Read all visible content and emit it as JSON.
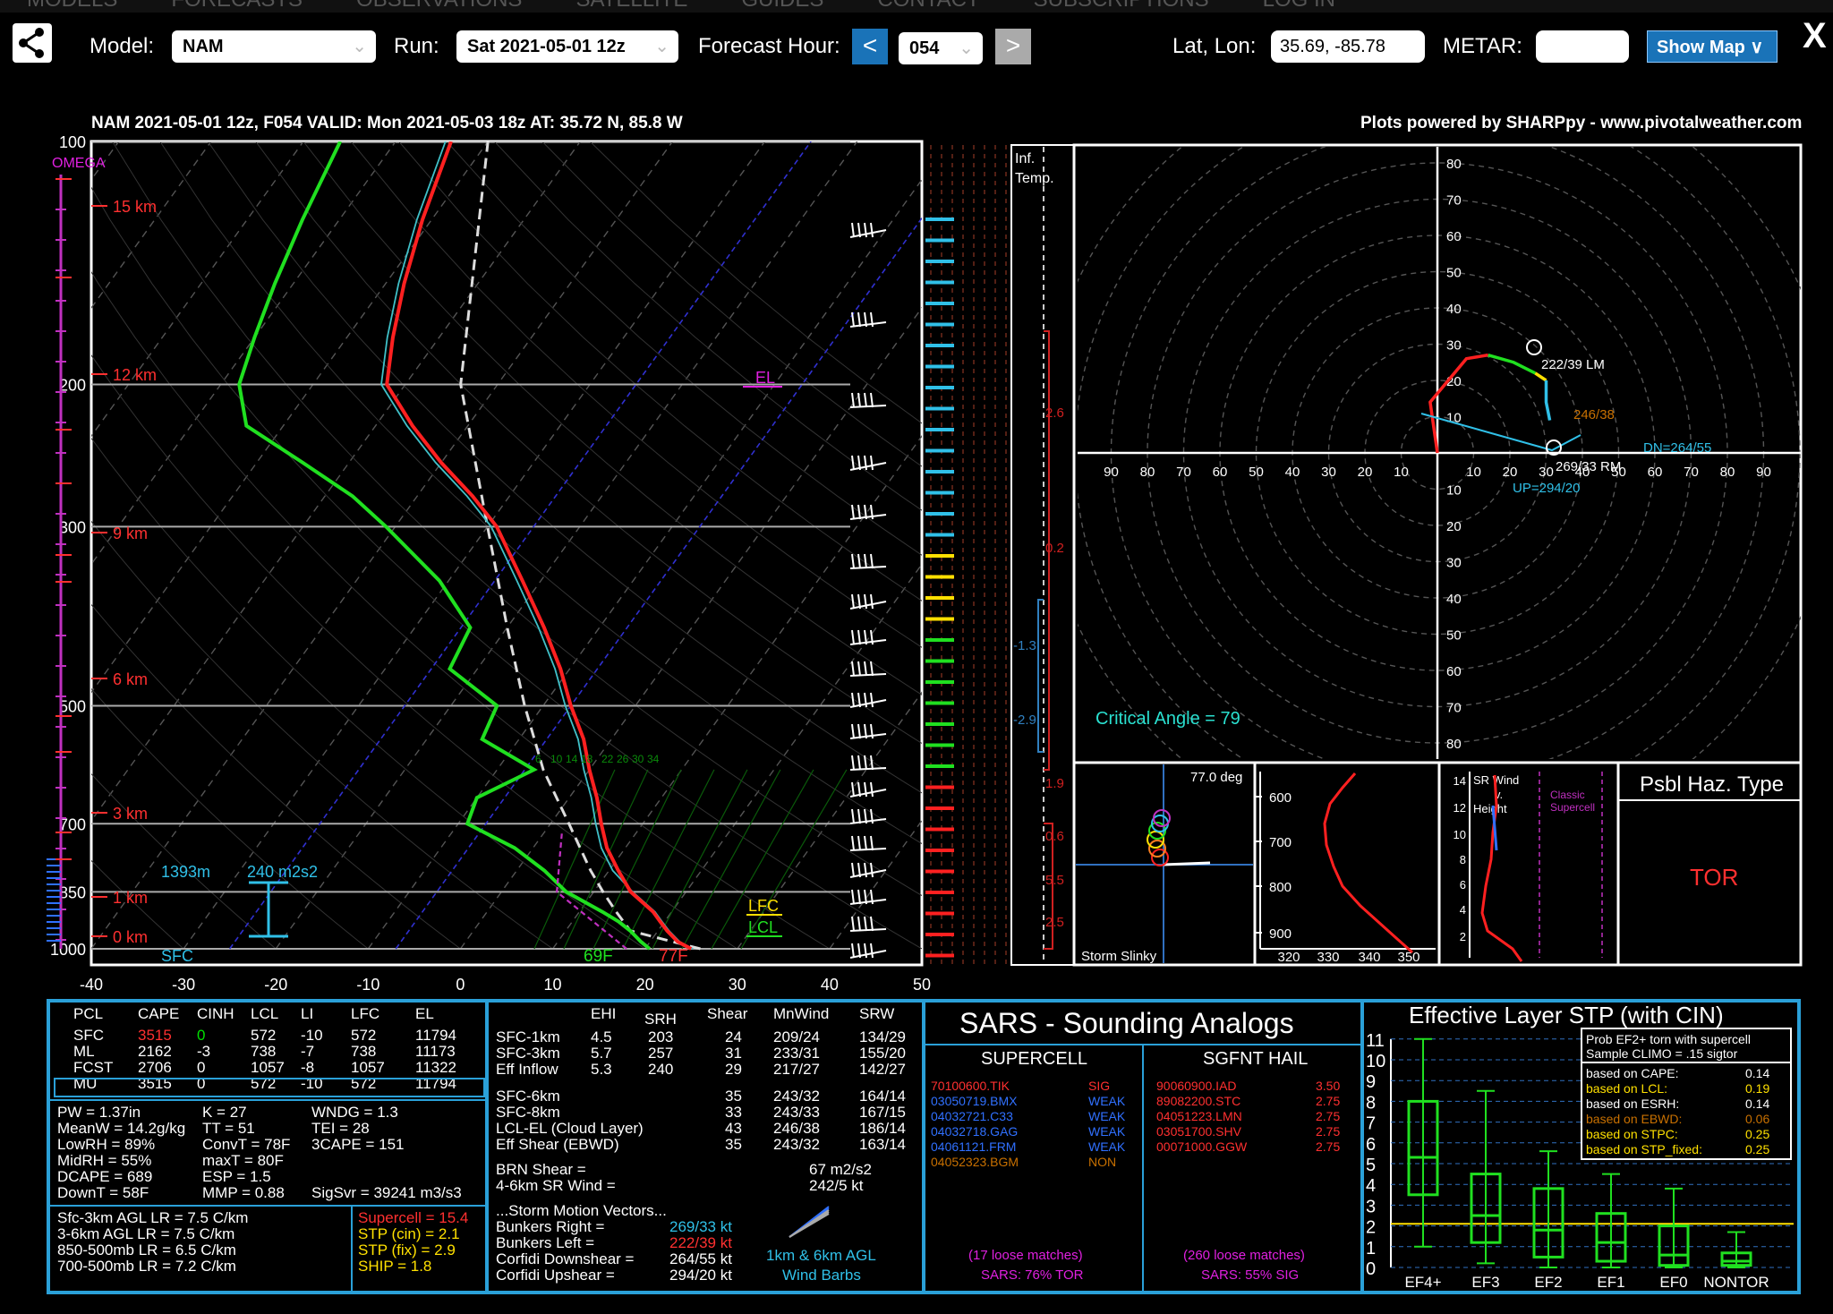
{
  "nav": {
    "items": [
      "MODELS",
      "FORECASTS",
      "OBSERVATIONS",
      "SATELLITE",
      "GUIDES",
      "CONTACT",
      "SUBSCRIPTIONS",
      "LOG IN"
    ]
  },
  "toolbar": {
    "model_label": "Model:",
    "model_value": "NAM",
    "run_label": "Run:",
    "run_value": "Sat 2021-05-01 12z",
    "fh_label": "Forecast Hour:",
    "fh_prev": "<",
    "fh_value": "054",
    "fh_next": ">",
    "latlon_label": "Lat, Lon:",
    "latlon_value": "35.69, -85.78",
    "metar_label": "METAR:",
    "metar_value": "",
    "showmap": "Show Map ∨",
    "close": "X"
  },
  "skewt": {
    "title": "NAM 2021-05-01 12z, F054  VALID: Mon 2021-05-03 18z  AT: 35.72 N, 85.8 W",
    "credit": "Plots powered by SHARPpy - www.pivotalweather.com",
    "omega": "OMEGA",
    "pressure_ticks": [
      "100",
      "200",
      "300",
      "500",
      "700",
      "850",
      "1000"
    ],
    "height_ticks": [
      "15 km",
      "12 km",
      "9 km",
      "6 km",
      "3 km",
      "1 km",
      "0 km"
    ],
    "temp_ticks": [
      "-40",
      "-30",
      "-20",
      "-10",
      "0",
      "10",
      "20",
      "30",
      "40",
      "50"
    ],
    "mixing_ticks": [
      "6",
      "10",
      "14",
      "18",
      "22",
      "26",
      "30",
      "34"
    ],
    "el": "EL",
    "lfc": "LFC",
    "lcl": "LCL",
    "sfc": "SFC",
    "eff_depth": "1393m",
    "eff_srh": "240 m2s2",
    "sfc_td": "69F",
    "sfc_t": "77F",
    "inf_temp": "Inf.\nTemp.",
    "inf_vals": [
      "2.6",
      "0.2",
      "-1.3",
      "-2.9",
      "1.9",
      "0.6",
      "5.5",
      "2.5"
    ]
  },
  "hodo": {
    "rings": [
      "10",
      "20",
      "30",
      "40",
      "50",
      "60",
      "70",
      "80"
    ],
    "x_left": [
      "90",
      "80",
      "70",
      "60",
      "50",
      "40",
      "30",
      "20",
      "10"
    ],
    "x_right": [
      "10",
      "20",
      "30",
      "40",
      "50",
      "60",
      "70",
      "80",
      "90"
    ],
    "lm": "222/39 LM",
    "rm": "269/33 RM",
    "dn": "DN=264/55",
    "up": "UP=294/20",
    "mean": "246/38",
    "critical": "Critical Angle = 79"
  },
  "slinky": {
    "deg": "77.0 deg",
    "label": "Storm Slinky"
  },
  "theta": {
    "y": [
      "600",
      "700",
      "800",
      "900"
    ],
    "x": [
      "320",
      "330",
      "340",
      "350"
    ]
  },
  "srwind": {
    "title": "SR Wind\nv.\nHeight",
    "classic": "Classic\nSupercell",
    "y": [
      "14",
      "12",
      "10",
      "8",
      "6",
      "4",
      "2"
    ]
  },
  "haz": {
    "title": "Psbl Haz. Type",
    "value": "TOR"
  },
  "parcels": {
    "headers": [
      "PCL",
      "CAPE",
      "CINH",
      "LCL",
      "LI",
      "LFC",
      "EL"
    ],
    "rows": [
      [
        "SFC",
        "3515",
        "0",
        "572",
        "-10",
        "572",
        "11794"
      ],
      [
        "ML",
        "2162",
        "-3",
        "738",
        "-7",
        "738",
        "11173"
      ],
      [
        "FCST",
        "2706",
        "0",
        "1057",
        "-8",
        "1057",
        "11322"
      ],
      [
        "MU",
        "3515",
        "0",
        "572",
        "-10",
        "572",
        "11794"
      ]
    ]
  },
  "indices": {
    "col1": [
      "PW = 1.37in",
      "MeanW = 14.2g/kg",
      "LowRH = 89%",
      "MidRH = 55%",
      "DCAPE = 689",
      "DownT = 58F"
    ],
    "col2": [
      "K = 27",
      "TT = 51",
      "ConvT = 78F",
      "maxT = 80F",
      "ESP = 1.5",
      "MMP = 0.88"
    ],
    "col3": [
      "WNDG = 1.3",
      "TEI = 28",
      "3CAPE = 151",
      "",
      "",
      "SigSvr = 39241 m3/s3"
    ]
  },
  "lapse": [
    "Sfc-3km AGL LR = 7.5 C/km",
    "3-6km AGL LR = 7.5 C/km",
    "850-500mb LR = 6.5 C/km",
    "700-500mb LR = 7.2 C/km"
  ],
  "comp": [
    "Supercell = 15.4",
    "STP (cin) = 2.1",
    "STP (fix) = 2.9",
    "SHIP = 1.8"
  ],
  "kin": {
    "headers": [
      "EHI",
      "SRH",
      "Shear",
      "MnWind",
      "SRW"
    ],
    "rows": [
      [
        "SFC-1km",
        "4.5",
        "203",
        "24",
        "209/24",
        "134/29"
      ],
      [
        "SFC-3km",
        "5.7",
        "257",
        "31",
        "233/31",
        "155/20"
      ],
      [
        "Eff Inflow",
        "5.3",
        "240",
        "29",
        "217/27",
        "142/27"
      ],
      [
        "SFC-6km",
        "",
        "",
        "35",
        "243/32",
        "164/14"
      ],
      [
        "SFC-8km",
        "",
        "",
        "33",
        "243/33",
        "167/15"
      ],
      [
        "LCL-EL (Cloud Layer)",
        "",
        "",
        "43",
        "246/38",
        "186/14"
      ],
      [
        "Eff Shear (EBWD)",
        "",
        "",
        "35",
        "243/32",
        "163/14"
      ]
    ],
    "brn_label": "BRN Shear =",
    "brn": "67 m2/s2",
    "sr46_label": "4-6km SR Wind =",
    "sr46": "242/5 kt",
    "smv": "...Storm Motion Vectors...",
    "br_label": "Bunkers Right =",
    "br": "269/33 kt",
    "bl_label": "Bunkers Left =",
    "bl": "222/39 kt",
    "cd_label": "Corfidi Downshear =",
    "cd": "264/55 kt",
    "cu_label": "Corfidi Upshear =",
    "cu": "294/20 kt",
    "barbs": "1km & 6km AGL\nWind Barbs"
  },
  "sars": {
    "title": "SARS - Sounding Analogs",
    "sup_title": "SUPERCELL",
    "hail_title": "SGFNT HAIL",
    "sup": [
      [
        "70100600.TIK",
        "SIG"
      ],
      [
        "03050719.BMX",
        "WEAK"
      ],
      [
        "04032721.C33",
        "WEAK"
      ],
      [
        "04032718.GAG",
        "WEAK"
      ],
      [
        "04061121.FRM",
        "WEAK"
      ],
      [
        "04052323.BGM",
        "NON"
      ]
    ],
    "hail": [
      [
        "90060900.IAD",
        "3.50"
      ],
      [
        "89082200.STC",
        "2.75"
      ],
      [
        "04051223.LMN",
        "2.75"
      ],
      [
        "03051700.SHV",
        "2.75"
      ],
      [
        "00071000.GGW",
        "2.75"
      ]
    ],
    "sup_matches": "(17 loose matches)",
    "sup_sars": "SARS: 76% TOR",
    "hail_matches": "(260 loose matches)",
    "hail_sars": "SARS: 55% SIG"
  },
  "stp": {
    "title": "Effective Layer STP (with CIN)",
    "y": [
      "11",
      "10",
      "9",
      "8",
      "7",
      "6",
      "5",
      "4",
      "3",
      "2",
      "1",
      "0"
    ],
    "cats": [
      "EF4+",
      "EF3",
      "EF2",
      "EF1",
      "EF0",
      "NONTOR"
    ],
    "prob_title": "Prob EF2+ torn with supercell",
    "prob_sub": "Sample CLIMO = .15 sigtor",
    "probs": [
      [
        "based on CAPE:",
        "0.14"
      ],
      [
        "based on LCL:",
        "0.19"
      ],
      [
        "based on ESRH:",
        "0.14"
      ],
      [
        "based on EBWD:",
        "0.06"
      ],
      [
        "based on STPC:",
        "0.25"
      ],
      [
        "based on STP_fixed:",
        "0.25"
      ]
    ]
  },
  "chart_data": {
    "type": "line",
    "title": "NAM 2021-05-01 12z, F054  VALID: Mon 2021-05-03 18z  AT: 35.72 N, 85.8 W",
    "xlabel": "",
    "ylabel": "",
    "xlim": [
      -40,
      50
    ],
    "ylim": [
      1000,
      100
    ],
    "series": [
      {
        "name": "",
        "p": [
          1000,
          980,
          950,
          925,
          900,
          850,
          800,
          750,
          700,
          650,
          600,
          550,
          500,
          450,
          400,
          350,
          300,
          275,
          250,
          225,
          200,
          175,
          150,
          125,
          100
        ],
        "values": [
          25,
          23,
          21,
          19.5,
          18,
          14,
          11,
          8,
          5.5,
          3,
          0,
          -3,
          -7,
          -11,
          -16,
          -22,
          -29,
          -34,
          -40,
          -46,
          -52,
          -55,
          -58,
          -61,
          -64
        ]
      },
      {
        "name": "",
        "p": [
          1000,
          980,
          950,
          925,
          900,
          850,
          800,
          750,
          700,
          650,
          600,
          550,
          500,
          450,
          400,
          350,
          300,
          275,
          250,
          225,
          200,
          175,
          150,
          125,
          100
        ],
        "values": [
          20.5,
          19,
          17,
          15,
          12.5,
          7,
          3,
          -2,
          -9,
          -10,
          -6,
          -14,
          -15,
          -23,
          -24,
          -31,
          -41,
          -47,
          -55,
          -64,
          -68,
          -70,
          -72,
          -74,
          -76
        ]
      },
      {
        "name": "",
        "p": [
          1000,
          950,
          900,
          850,
          800,
          700,
          600,
          500,
          400,
          300,
          200,
          100
        ],
        "values": [
          26,
          17,
          14,
          11,
          8,
          2,
          -5,
          -12,
          -20,
          -30,
          -44,
          -60
        ]
      }
    ],
    "hodograph": [
      [
        0,
        0
      ],
      [
        -2,
        14
      ],
      [
        3,
        20
      ],
      [
        8,
        26
      ],
      [
        14,
        27
      ],
      [
        21,
        25
      ],
      [
        27,
        22
      ],
      [
        30,
        20
      ],
      [
        30,
        14
      ],
      [
        31,
        9
      ]
    ]
  }
}
